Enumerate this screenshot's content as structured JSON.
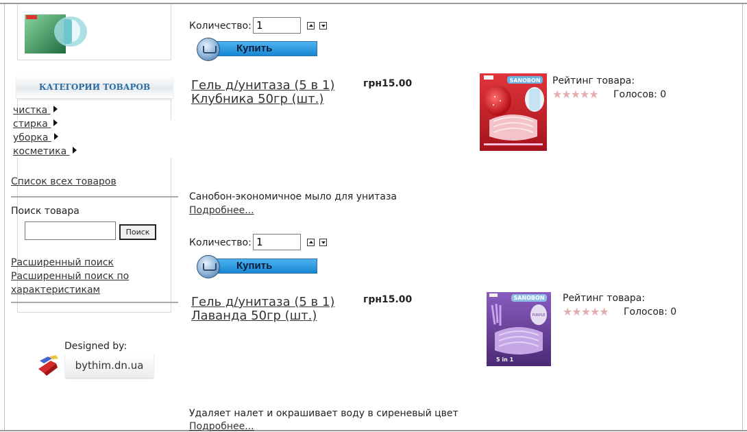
{
  "sidebar": {
    "categories_header": "КАТЕГОРИИ ТОВАРОВ",
    "categories": [
      {
        "label": "чистка"
      },
      {
        "label": "стирка"
      },
      {
        "label": "уборка"
      },
      {
        "label": "косметика"
      }
    ],
    "all_products_link": "Список всех товаров",
    "search_label": "Поиск товара",
    "search_button": "Поиск",
    "search_value": "",
    "advanced_search_link": "Расширенный поиск",
    "advanced_search_by_features_line1": "Расширенный поиск по",
    "advanced_search_by_features_line2": "характеристикам",
    "designed_by_label": "Designed by:",
    "designer_name": "bythim.dn.ua"
  },
  "top_product": {
    "quantity_label": "Количество:",
    "quantity_value": "1",
    "buy_label": "Купить"
  },
  "products": [
    {
      "title_line1": "Гель д/унитаза (5 в 1)",
      "title_line2": "Клубника 50гр (шт.)",
      "price": "грн15.00",
      "rating_label": "Рейтинг товара:",
      "votes_label": "Голосов: 0",
      "description": "Санобон-экономичное мыло для унитаза",
      "more_link": "Подробнее...",
      "quantity_label": "Количество:",
      "quantity_value": "1",
      "buy_label": "Купить",
      "image_brand": "SANOBON",
      "image_accent": "#c9202a"
    },
    {
      "title_line1": "Гель д/унитаза (5 в 1)",
      "title_line2": "Лаванда 50гр (шт.)",
      "price": "грн15.00",
      "rating_label": "Рейтинг товара:",
      "votes_label": "Голосов: 0",
      "description": "Удаляет налет и окрашивает воду в сиреневый цвет",
      "more_link": "Подробнее...",
      "image_brand": "SANOBON",
      "image_accent": "#6a3f9a",
      "image_badge": "5 in 1",
      "image_note": "PURPLE"
    }
  ],
  "rating_stars": "★★★★★",
  "colors": {
    "category_header_text": "#2b6da3",
    "buy_button": "#1f8fdc",
    "stars": "#e3aeb0"
  }
}
